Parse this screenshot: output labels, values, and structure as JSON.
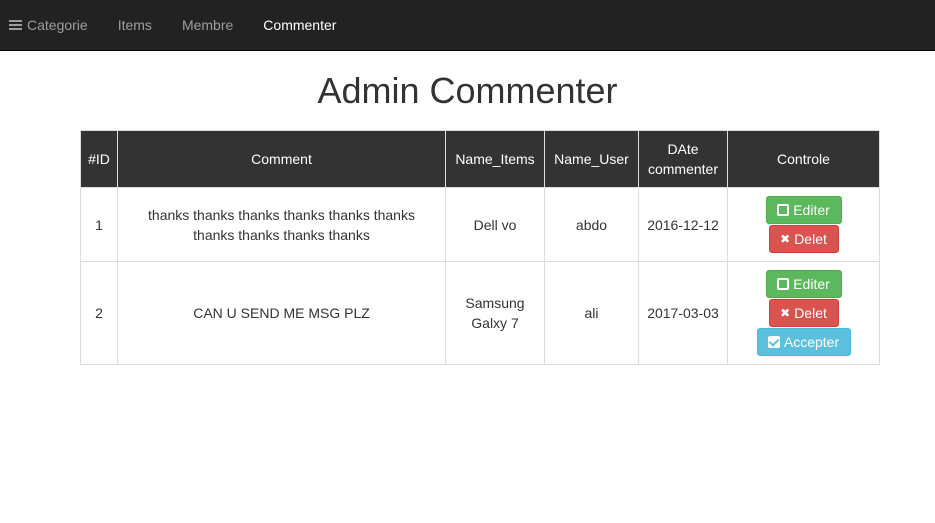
{
  "nav": {
    "items": [
      {
        "label": "Categorie",
        "active": false,
        "icon": "bars-icon"
      },
      {
        "label": "Items",
        "active": false
      },
      {
        "label": "Membre",
        "active": false
      },
      {
        "label": "Commenter",
        "active": true
      }
    ]
  },
  "page": {
    "title": "Admin Commenter"
  },
  "table": {
    "headers": [
      "#ID",
      "Comment",
      "Name_Items",
      "Name_User",
      "DAte commenter",
      "Controle"
    ],
    "rows": [
      {
        "id": "1",
        "comment": "thanks thanks thanks thanks thanks thanks thanks thanks thanks thanks",
        "item": "Dell vo",
        "user": "abdo",
        "date": "2016-12-12",
        "buttons": {
          "edit": "Editer",
          "delete": "Delet"
        }
      },
      {
        "id": "2",
        "comment": "CAN U SEND ME MSG PLZ",
        "item": "Samsung Galxy 7",
        "user": "ali",
        "date": "2017-03-03",
        "buttons": {
          "edit": "Editer",
          "delete": "Delet",
          "accept": "Accepter"
        }
      }
    ]
  },
  "colors": {
    "navbar": "#222222",
    "header": "#333333",
    "success": "#5cb85c",
    "danger": "#d9534f",
    "info": "#5bc0de"
  }
}
